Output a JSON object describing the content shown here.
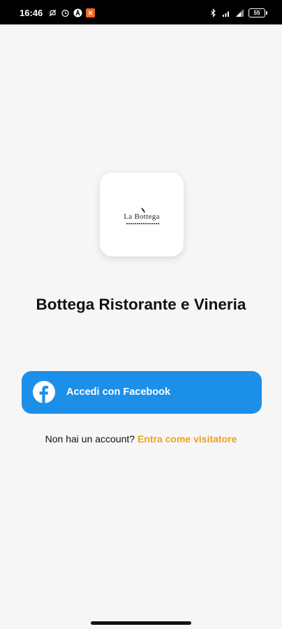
{
  "status_bar": {
    "time": "16:46",
    "battery": "55",
    "icons": [
      "mute-icon",
      "alarm-icon",
      "app-a-icon",
      "app-notification-icon",
      "bluetooth-icon",
      "wifi-signal-icon",
      "cell-signal-icon",
      "battery-icon"
    ]
  },
  "logo": {
    "text": "La Bottega"
  },
  "app_title": "Bottega Ristorante e Vineria",
  "facebook_button": {
    "label": "Accedi con Facebook",
    "icon": "facebook-icon",
    "color": "#1c8fe8"
  },
  "signup": {
    "question": "Non hai un account?",
    "link": "Entra come visitatore",
    "link_color": "#f0a11d"
  }
}
